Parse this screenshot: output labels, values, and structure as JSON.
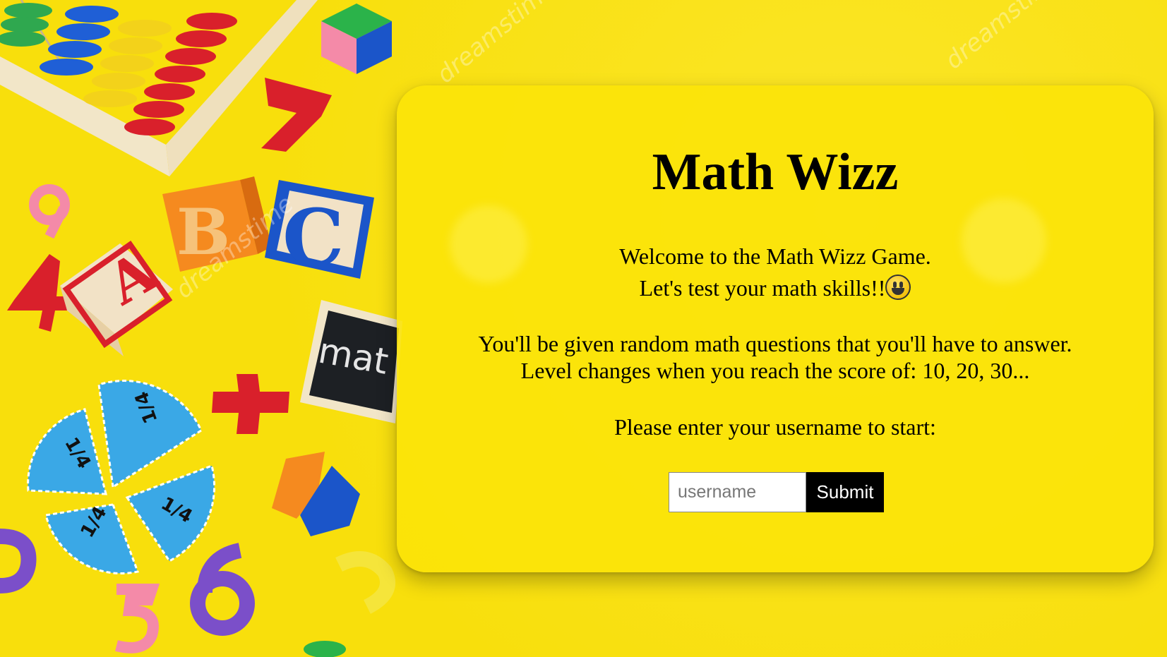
{
  "game": {
    "title": "Math Wizz",
    "welcome_line1": "Welcome to the Math Wizz Game.",
    "welcome_line2": "Let's test your math skills!!",
    "emoji_icon": "grinning-face-icon",
    "rules_line1": "You'll be given random math questions that you'll have to answer.",
    "rules_line2": "Level changes when you reach the score of: 10, 20, 30...",
    "prompt": "Please enter your username to start:"
  },
  "form": {
    "username_placeholder": "username",
    "username_value": "",
    "submit_label": "Submit"
  },
  "background": {
    "watermark": "dreamstime",
    "colors": {
      "background": "#f8df0c",
      "card": "#fae408"
    }
  }
}
